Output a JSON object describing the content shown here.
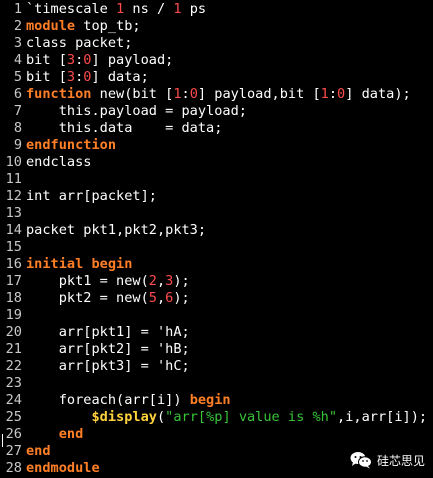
{
  "editor": {
    "lines": [
      {
        "n": "1",
        "tokens": [
          [
            "plain",
            "`timescale "
          ],
          [
            "num",
            "1"
          ],
          [
            "plain",
            " ns / "
          ],
          [
            "num",
            "1"
          ],
          [
            "plain",
            " ps"
          ]
        ]
      },
      {
        "n": "2",
        "tokens": [
          [
            "kw",
            "module"
          ],
          [
            "plain",
            " top_tb;"
          ]
        ]
      },
      {
        "n": "3",
        "tokens": [
          [
            "plain",
            "class packet;"
          ]
        ]
      },
      {
        "n": "4",
        "tokens": [
          [
            "plain",
            "bit ["
          ],
          [
            "num",
            "3"
          ],
          [
            "plain",
            ":"
          ],
          [
            "num",
            "0"
          ],
          [
            "plain",
            "] payload;"
          ]
        ]
      },
      {
        "n": "5",
        "tokens": [
          [
            "plain",
            "bit ["
          ],
          [
            "num",
            "3"
          ],
          [
            "plain",
            ":"
          ],
          [
            "num",
            "0"
          ],
          [
            "plain",
            "] data;"
          ]
        ]
      },
      {
        "n": "6",
        "tokens": [
          [
            "kw",
            "function"
          ],
          [
            "plain",
            " new(bit ["
          ],
          [
            "num",
            "1"
          ],
          [
            "plain",
            ":"
          ],
          [
            "num",
            "0"
          ],
          [
            "plain",
            "] payload,bit ["
          ],
          [
            "num",
            "1"
          ],
          [
            "plain",
            ":"
          ],
          [
            "num",
            "0"
          ],
          [
            "plain",
            "] data);"
          ]
        ]
      },
      {
        "n": "7",
        "tokens": [
          [
            "plain",
            "    this.payload = payload;"
          ]
        ]
      },
      {
        "n": "8",
        "tokens": [
          [
            "plain",
            "    this.data    = data;"
          ]
        ]
      },
      {
        "n": "9",
        "tokens": [
          [
            "kw",
            "endfunction"
          ]
        ]
      },
      {
        "n": "10",
        "tokens": [
          [
            "plain",
            "endclass"
          ]
        ]
      },
      {
        "n": "11",
        "tokens": []
      },
      {
        "n": "12",
        "tokens": [
          [
            "plain",
            "int arr[packet];"
          ]
        ]
      },
      {
        "n": "13",
        "tokens": []
      },
      {
        "n": "14",
        "tokens": [
          [
            "plain",
            "packet pkt1,pkt2,pkt3;"
          ]
        ]
      },
      {
        "n": "15",
        "tokens": []
      },
      {
        "n": "16",
        "tokens": [
          [
            "kw",
            "initial begin"
          ]
        ]
      },
      {
        "n": "17",
        "tokens": [
          [
            "plain",
            "    pkt1 = new("
          ],
          [
            "num",
            "2"
          ],
          [
            "plain",
            ","
          ],
          [
            "num",
            "3"
          ],
          [
            "plain",
            ");"
          ]
        ]
      },
      {
        "n": "18",
        "tokens": [
          [
            "plain",
            "    pkt2 = new("
          ],
          [
            "num",
            "5"
          ],
          [
            "plain",
            ","
          ],
          [
            "num",
            "6"
          ],
          [
            "plain",
            ");"
          ]
        ]
      },
      {
        "n": "19",
        "tokens": []
      },
      {
        "n": "20",
        "tokens": [
          [
            "plain",
            "    arr[pkt1] = 'hA;"
          ]
        ]
      },
      {
        "n": "21",
        "tokens": [
          [
            "plain",
            "    arr[pkt2] = 'hB;"
          ]
        ]
      },
      {
        "n": "22",
        "tokens": [
          [
            "plain",
            "    arr[pkt3] = 'hC;"
          ]
        ]
      },
      {
        "n": "23",
        "tokens": []
      },
      {
        "n": "24",
        "tokens": [
          [
            "plain",
            "    foreach(arr[i]) "
          ],
          [
            "kw",
            "begin"
          ]
        ]
      },
      {
        "n": "25",
        "tokens": [
          [
            "plain",
            "        "
          ],
          [
            "sys",
            "$display"
          ],
          [
            "plain",
            "("
          ],
          [
            "str",
            "\"arr[%p] value is %h\""
          ],
          [
            "plain",
            ",i,arr[i]);"
          ]
        ]
      },
      {
        "n": "26",
        "tokens": [
          [
            "plain",
            "    "
          ],
          [
            "kw",
            "end"
          ]
        ]
      },
      {
        "n": "27",
        "tokens": [
          [
            "kw",
            "end"
          ]
        ]
      },
      {
        "n": "28",
        "tokens": [
          [
            "kw",
            "endmodule"
          ]
        ]
      }
    ]
  },
  "watermark": {
    "icon": "wechat-icon",
    "text": "硅芯思见"
  }
}
